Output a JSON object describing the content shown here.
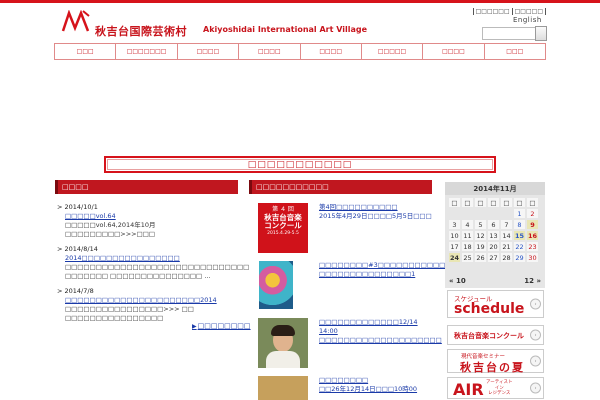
{
  "header": {
    "site_title": "秋吉台国際芸術村",
    "site_title_en": "Akiyoshidai International Art Village",
    "top_links": [
      "□□□□□□",
      "□□□□□"
    ],
    "lang": "English"
  },
  "gnav": [
    "□□□",
    "□□□□□□□",
    "□□□□",
    "□□□□",
    "□□□□",
    "□□□□□",
    "□□□□",
    "□□□"
  ],
  "banner": "□□□□□□□□□□□",
  "news": {
    "heading": "□□□□",
    "entries": [
      {
        "date": "2014/10/1",
        "link": "□□□□□vol.64",
        "text": "□□□□□vol.64,2014年10月□□□□□□□□□>>>□□□"
      },
      {
        "date": "2014/8/14",
        "link": "2014□□□□□□□□□□□□□□□□",
        "text": "□□□□□□□□□□□□□□□□□□□□□□□□□□□□□□ □□□□□□□ □□□□□□□□□□□□□□□ …"
      },
      {
        "date": "2014/7/8",
        "link": "□□□□□□□□□□□□□□□□□□□□□□2014",
        "text": "□□□□□□□□□□□□□□□□>>> □□ □□□□□□□□□□□□□□□□"
      }
    ],
    "more": "□□□□□□□□"
  },
  "events": {
    "heading": "□□□□□□□□□□□",
    "items": [
      {
        "title": "第4回□□□□□□□□□□",
        "sub": "2015年4月29日□□□□5月5日□□□"
      },
      {
        "title": "□□□□□□□□#3□□□□□□□□□□□□□□□□□□□□□□□□□□□",
        "sub": "□□□□□□□□□□□□□□□1"
      },
      {
        "title": "□□□□□□□□□□□□□12/14 14:00 □□□□□□□□□□□□□□□□□□□□",
        "sub": ""
      },
      {
        "title": "□□□□□□□□",
        "sub": "□□26年12月14日□□□10時00"
      }
    ],
    "poster": {
      "top": "第 ４ 回",
      "line1": "秋吉台音楽",
      "line2": "コンクール",
      "dates": "2015.4.29-5.5"
    }
  },
  "calendar": {
    "title": "2014年11月",
    "weekdays": [
      "□",
      "□",
      "□",
      "□",
      "□",
      "□",
      "□"
    ],
    "rows": [
      [
        "",
        "",
        "",
        "",
        "",
        "1",
        "2"
      ],
      [
        "3",
        "4",
        "5",
        "6",
        "7",
        "8",
        "9"
      ],
      [
        "10",
        "11",
        "12",
        "13",
        "14",
        "15",
        "16"
      ],
      [
        "17",
        "18",
        "19",
        "20",
        "21",
        "22",
        "23"
      ],
      [
        "24",
        "25",
        "26",
        "27",
        "28",
        "29",
        "30"
      ]
    ],
    "prev": "« 10",
    "next": "12 »"
  },
  "side": {
    "schedule_small": "スケジュール",
    "schedule_big": "schedule",
    "concours": "秋吉台音楽コンクール",
    "summer_small": "現代音楽セミナー",
    "summer_big": "秋吉台の夏",
    "air_big": "AIR",
    "air_small": "アーティスト\nイン\nレジデンス"
  },
  "colors": {
    "brand_red": "#c8141c",
    "link": "#1a3aa8"
  }
}
